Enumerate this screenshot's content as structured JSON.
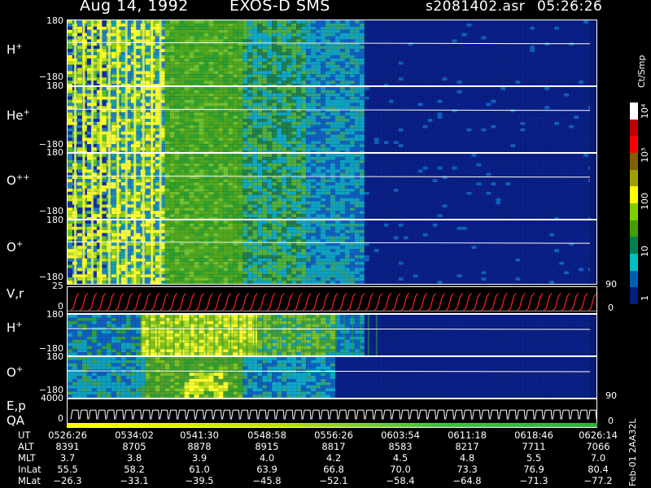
{
  "header": {
    "date": "Aug 14, 1992",
    "instrument": "EXOS-D SMS",
    "file": "s2081402.asr",
    "time": "05:26:26"
  },
  "panels": [
    {
      "label": "H",
      "charge": "+",
      "top_tick": "180",
      "bottom_tick": "−180"
    },
    {
      "label": "He",
      "charge": "+",
      "top_tick": "180",
      "bottom_tick": "−180"
    },
    {
      "label": "O",
      "charge": "++",
      "top_tick": "180",
      "bottom_tick": "−180"
    },
    {
      "label": "O",
      "charge": "+",
      "top_tick": "180",
      "bottom_tick": "−180"
    }
  ],
  "vr_panel": {
    "label": "V,r",
    "left_top": "25",
    "left_bottom": "0",
    "right_top": "90",
    "right_bottom": "0"
  },
  "lower_panels": [
    {
      "label": "H",
      "charge": "+",
      "top_tick": "180",
      "bottom_tick": "−180"
    },
    {
      "label": "O",
      "charge": "+",
      "top_tick": "180",
      "bottom_tick": "−180"
    }
  ],
  "lower_right_tick": "90",
  "ep_panel": {
    "label1": "E,p",
    "label2": "QA",
    "left_top": "4000",
    "left_bottom": "0",
    "right_bottom": "0"
  },
  "colorbar": {
    "unit": "Ct/Smp",
    "labels": [
      "10⁴",
      "10³",
      "100",
      "10",
      "1"
    ],
    "colors": [
      "#ffffff",
      "#c00000",
      "#ff0000",
      "#806000",
      "#a0a000",
      "#ffff00",
      "#80d000",
      "#40a000",
      "#008050",
      "#00c0c0",
      "#0060b0",
      "#002080"
    ]
  },
  "ephemeris": {
    "rows": [
      {
        "name": "UT",
        "values": [
          "0526:26",
          "0534:02",
          "0541:30",
          "0548:58",
          "0556:26",
          "0603:54",
          "0611:18",
          "0618:46",
          "0626:14"
        ]
      },
      {
        "name": "ALT",
        "values": [
          "8391",
          "8705",
          "8878",
          "8915",
          "8817",
          "8583",
          "8217",
          "7711",
          "7066"
        ]
      },
      {
        "name": "MLT",
        "values": [
          "3.7",
          "3.8",
          "3.9",
          "4.0",
          "4.2",
          "4.5",
          "4.8",
          "5.5",
          "7.0"
        ]
      },
      {
        "name": "InLat",
        "values": [
          "55.5",
          "58.2",
          "61.0",
          "63.9",
          "66.8",
          "70.0",
          "73.3",
          "76.9",
          "80.4"
        ]
      },
      {
        "name": "MLat",
        "values": [
          "−26.3",
          "−33.1",
          "−39.5",
          "−45.8",
          "−52.1",
          "−58.4",
          "−64.8",
          "−71.3",
          "−77.2"
        ]
      }
    ],
    "version": "Feb-01 2AA32L"
  }
}
